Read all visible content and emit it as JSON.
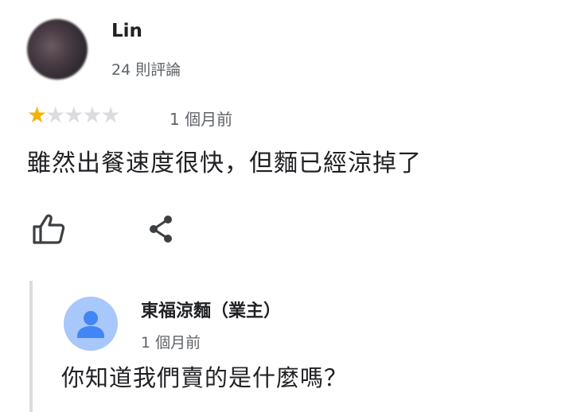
{
  "review": {
    "reviewer_name": "Lin",
    "review_count": "24 則評論",
    "rating": 1,
    "rating_max": 5,
    "time": "1 個月前",
    "text": "雖然出餐速度很快，但麵已經涼掉了",
    "star_color_on": "#f4b400",
    "star_color_off": "#dadce0",
    "icons": {
      "like": "thumbs-up-icon",
      "share": "share-icon"
    }
  },
  "reply": {
    "owner_name": "東福涼麵（業主）",
    "time": "1 個月前",
    "text": "你知道我們賣的是什麼嗎？",
    "avatar_color": "#a8c7fa",
    "avatar_fg_color": "#4285f4"
  }
}
